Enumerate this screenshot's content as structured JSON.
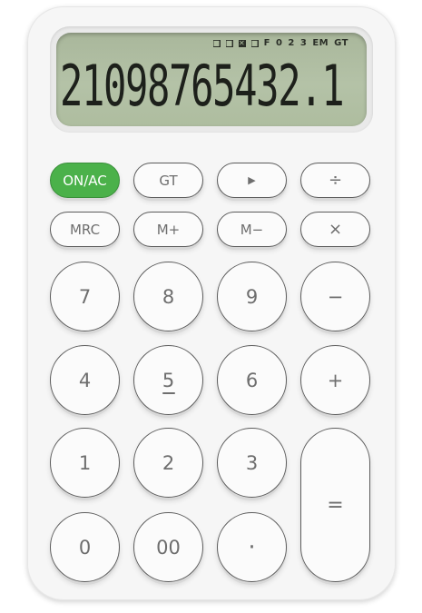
{
  "display": {
    "indicators": [
      "■",
      "■",
      "✕",
      "■",
      "F",
      "0",
      "2",
      "3",
      "EM",
      "GT"
    ],
    "digits": "21098765432.1"
  },
  "keys": {
    "on_ac": "ON/AC",
    "gt": "GT",
    "play": "▶",
    "divide": "÷",
    "mrc": "MRC",
    "m_plus": "M+",
    "m_minus": "M−",
    "multiply": "×",
    "seven": "7",
    "eight": "8",
    "nine": "9",
    "minus": "−",
    "four": "4",
    "five": "5",
    "six": "6",
    "plus": "+",
    "one": "1",
    "two": "2",
    "three": "3",
    "equals": "=",
    "zero": "0",
    "double_zero": "00",
    "decimal": "·"
  },
  "colors": {
    "accent": "#4bb14a",
    "lcd": "#aebd9f",
    "body": "#f6f6f6"
  }
}
